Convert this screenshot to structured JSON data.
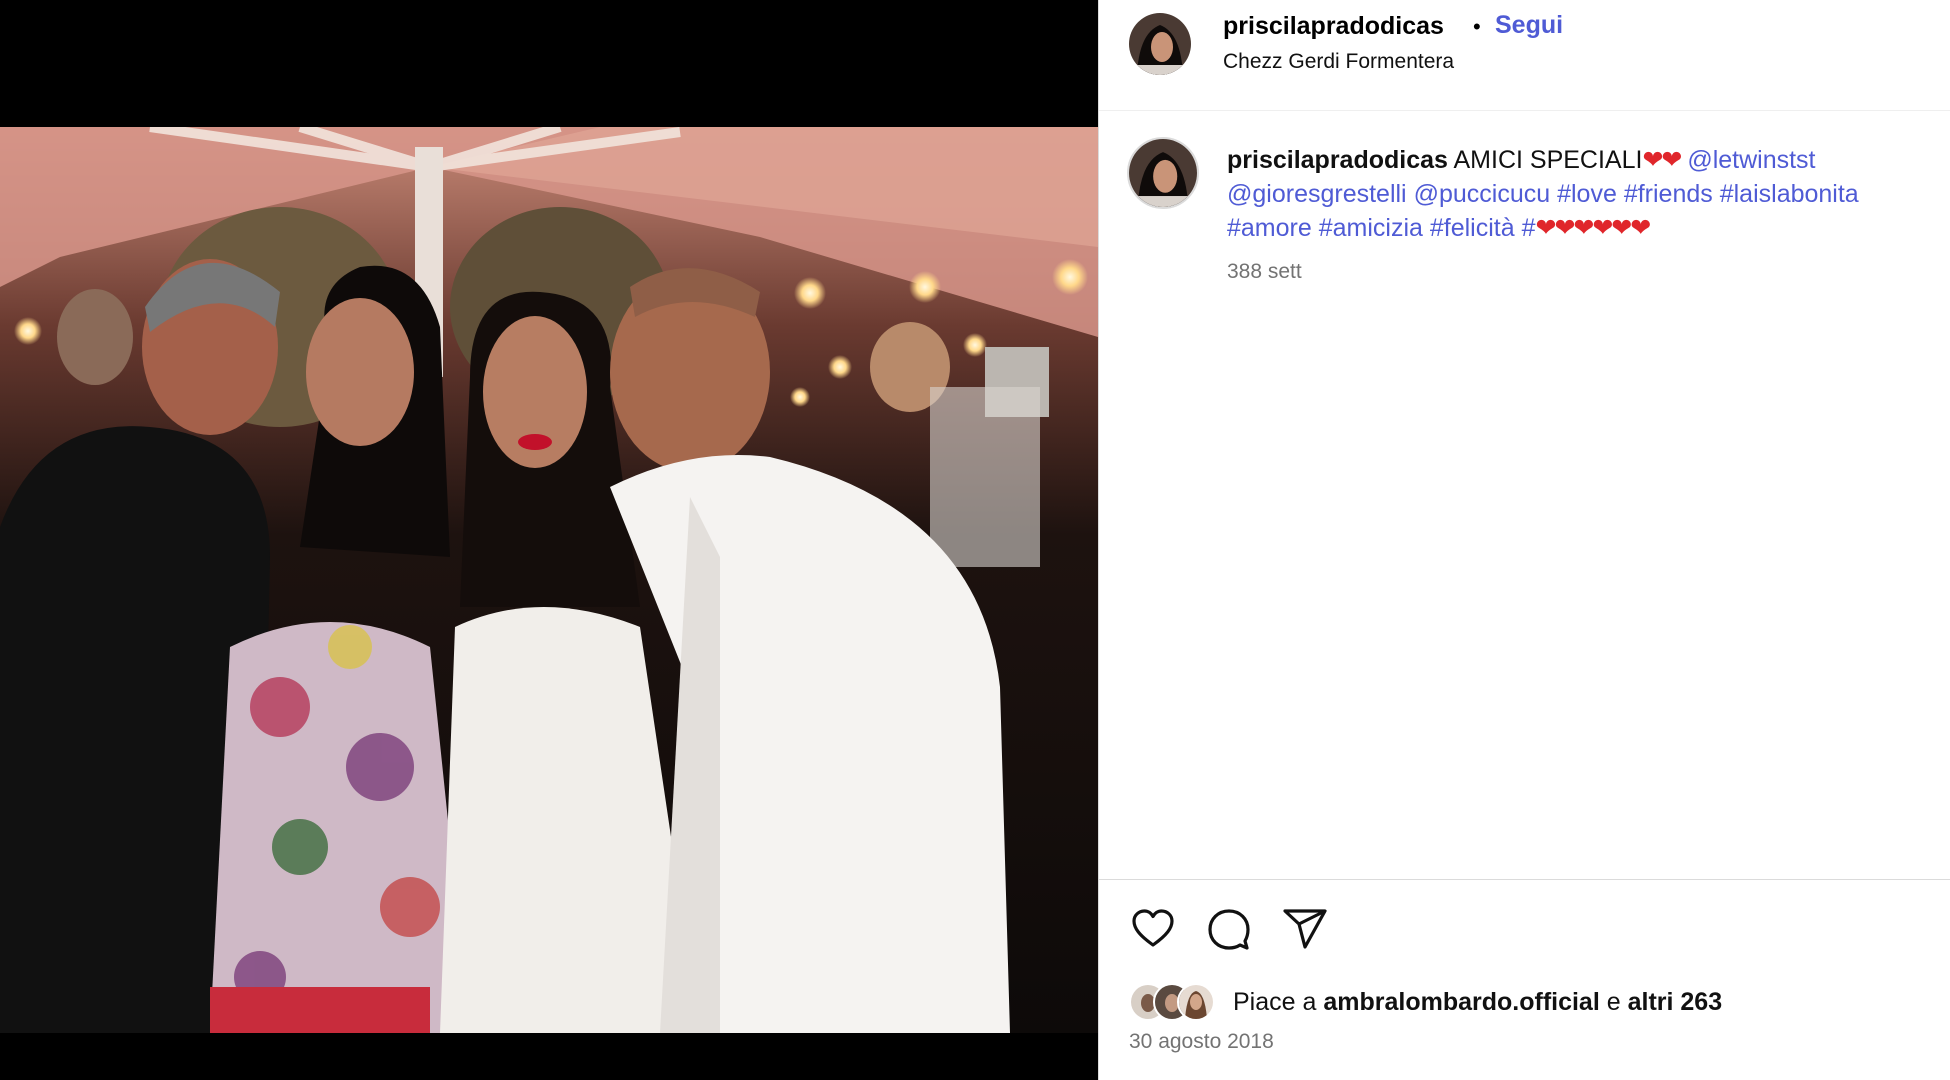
{
  "post": {
    "username": "priscilapradodicas",
    "dot": "•",
    "follow_label": "Segui",
    "location": "Chezz Gerdi Formentera"
  },
  "caption": {
    "username": "priscilapradodicas",
    "text_1": " AMICI SPECIALI",
    "hearts_1": "❤❤",
    "mention_1": "@letwinstst",
    "mention_2": "@gioresgrestelli",
    "mention_3": "@puccicucu",
    "tag_1": "#love",
    "tag_2": "#friends",
    "tag_3": "#laislabonita",
    "tag_4": "#amore",
    "tag_5": "#amicizia",
    "tag_6": "#felicità",
    "tag_7": "#",
    "hearts_2": "❤❤❤❤❤❤",
    "time": "388 sett"
  },
  "actions": {
    "like_icon": "heart-outline",
    "comment_icon": "speech-bubble",
    "share_icon": "paper-plane"
  },
  "likes": {
    "prefix": "Piace a ",
    "user": "ambralombardo.official",
    "middle": " e ",
    "others": "altri 263"
  },
  "date": "30 agosto 2018",
  "colors": {
    "link": "#4f5bd5",
    "heart": "#e0262b",
    "meta": "#737373"
  }
}
